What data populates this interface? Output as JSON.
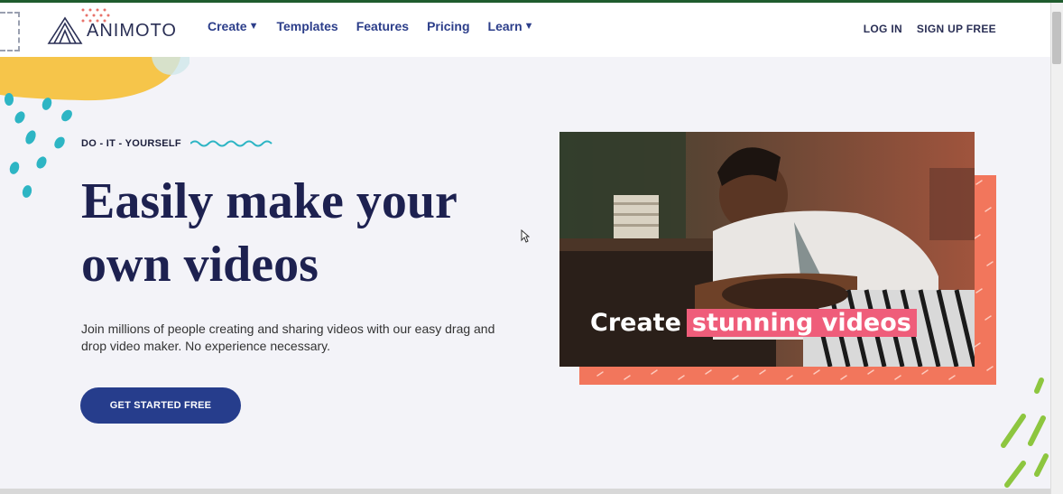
{
  "nav": {
    "logo_text": "ANIMOTO",
    "links": [
      {
        "label": "Create",
        "has_dropdown": true
      },
      {
        "label": "Templates",
        "has_dropdown": false
      },
      {
        "label": "Features",
        "has_dropdown": false
      },
      {
        "label": "Pricing",
        "has_dropdown": false
      },
      {
        "label": "Learn",
        "has_dropdown": true
      }
    ],
    "login_label": "LOG IN",
    "signup_label": "SIGN UP FREE"
  },
  "hero": {
    "eyebrow": "DO - IT - YOURSELF",
    "headline": "Easily make your own videos",
    "subtext": "Join millions of people creating and sharing videos with our easy drag and drop video maker. No experience necessary.",
    "cta_label": "GET STARTED FREE"
  },
  "media": {
    "caption_prefix": "Create",
    "caption_highlight": "stunning videos"
  },
  "colors": {
    "nav_link": "#2c3e8a",
    "headline": "#1d2150",
    "cta": "#263d8c",
    "coral": "#f2765c",
    "highlight": "#ef5d7a",
    "yellow": "#f6c54a",
    "teal": "#2db5c4"
  },
  "icons": [
    "animoto-logo-icon",
    "chevron-down-icon",
    "wave-icon",
    "mouse-cursor-icon"
  ]
}
